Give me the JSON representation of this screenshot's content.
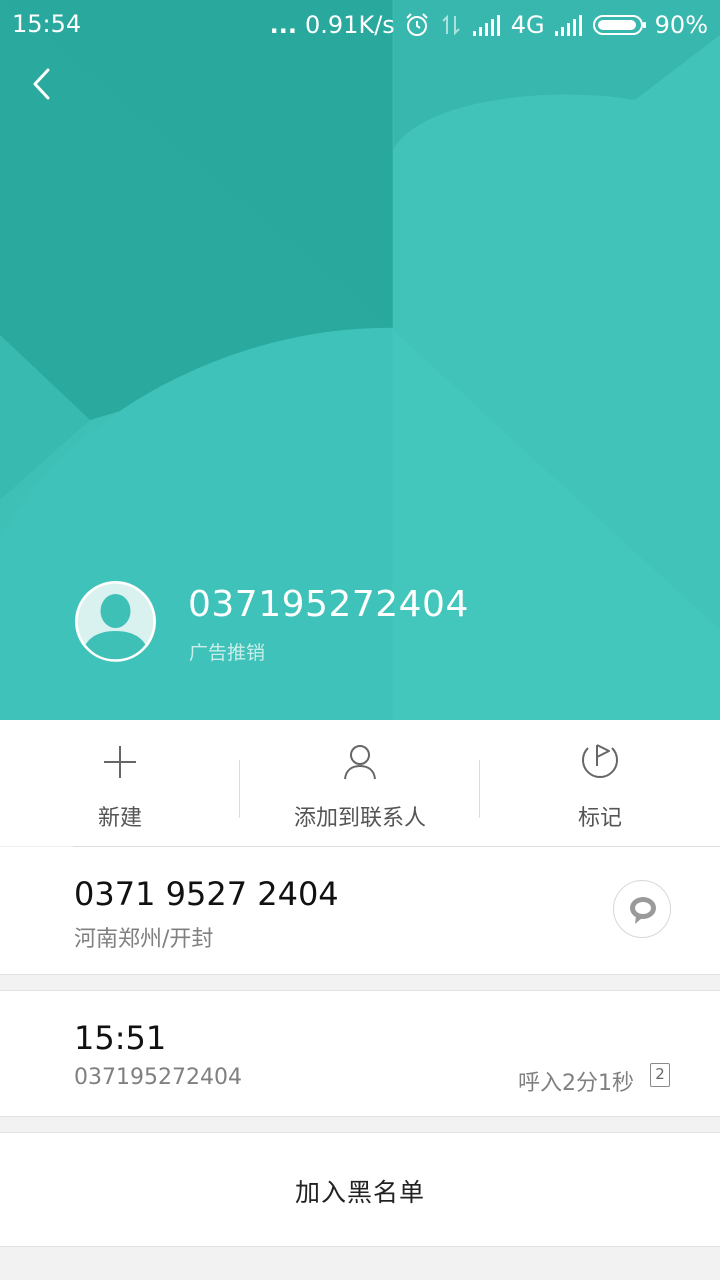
{
  "status_bar": {
    "time": "15:54",
    "dots": "...",
    "net_speed": "0.91K/s",
    "network": "4G",
    "battery": "90%"
  },
  "header": {
    "number": "037195272404",
    "tag": "广告推销"
  },
  "actions": [
    {
      "label": "新建",
      "icon": "plus-icon"
    },
    {
      "label": "添加到联系人",
      "icon": "person-icon"
    },
    {
      "label": "标记",
      "icon": "flag-icon"
    }
  ],
  "phone": {
    "number": "0371 9527 2404",
    "location": "河南郑州/开封"
  },
  "call_log": {
    "time": "15:51",
    "number": "037195272404",
    "detail": "呼入2分1秒",
    "sim": "2"
  },
  "blacklist_label": "加入黑名单",
  "colors": {
    "header_bg": "#3ec0b7",
    "header_dark": "#2aa79d"
  }
}
